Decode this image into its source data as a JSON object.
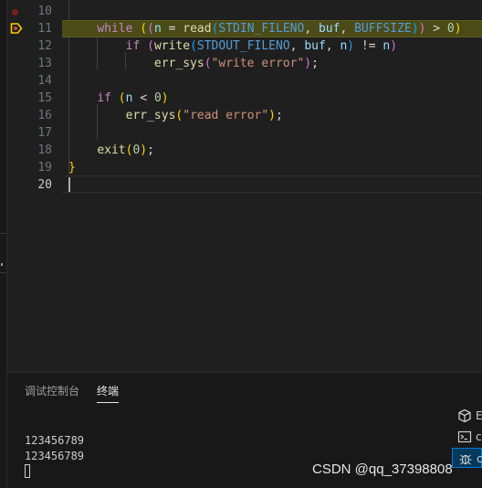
{
  "editor": {
    "lines": [
      {
        "num": "10"
      },
      {
        "num": "11",
        "tokens": [
          {
            "t": "    "
          },
          {
            "t": "while",
            "c": "kw"
          },
          {
            "t": " "
          },
          {
            "t": "(",
            "c": "p1"
          },
          {
            "t": "(",
            "c": "p2"
          },
          {
            "t": "n",
            "c": "var"
          },
          {
            "t": " = ",
            "c": "op"
          },
          {
            "t": "read",
            "c": "fn"
          },
          {
            "t": "(",
            "c": "p3"
          },
          {
            "t": "STDIN_FILENO",
            "c": "mac"
          },
          {
            "t": ", ",
            "c": "op"
          },
          {
            "t": "buf",
            "c": "var"
          },
          {
            "t": ", ",
            "c": "op"
          },
          {
            "t": "BUFFSIZE",
            "c": "mac"
          },
          {
            "t": ")",
            "c": "p3"
          },
          {
            "t": ")",
            "c": "p2"
          },
          {
            "t": " > ",
            "c": "op"
          },
          {
            "t": "0",
            "c": "num"
          },
          {
            "t": ")",
            "c": "p1"
          }
        ]
      },
      {
        "num": "12",
        "tokens": [
          {
            "t": "        "
          },
          {
            "t": "if",
            "c": "kw"
          },
          {
            "t": " "
          },
          {
            "t": "(",
            "c": "p2"
          },
          {
            "t": "write",
            "c": "fn"
          },
          {
            "t": "(",
            "c": "p3"
          },
          {
            "t": "STDOUT_FILENO",
            "c": "mac"
          },
          {
            "t": ", ",
            "c": "op"
          },
          {
            "t": "buf",
            "c": "var"
          },
          {
            "t": ", ",
            "c": "op"
          },
          {
            "t": "n",
            "c": "var"
          },
          {
            "t": ")",
            "c": "p3"
          },
          {
            "t": " != ",
            "c": "op"
          },
          {
            "t": "n",
            "c": "var"
          },
          {
            "t": ")",
            "c": "p2"
          }
        ]
      },
      {
        "num": "13",
        "tokens": [
          {
            "t": "            "
          },
          {
            "t": "err_sys",
            "c": "fn"
          },
          {
            "t": "(",
            "c": "p2"
          },
          {
            "t": "\"write error\"",
            "c": "str"
          },
          {
            "t": ")",
            "c": "p2"
          },
          {
            "t": ";",
            "c": "op"
          }
        ]
      },
      {
        "num": "14",
        "tokens": []
      },
      {
        "num": "15",
        "tokens": [
          {
            "t": "    "
          },
          {
            "t": "if",
            "c": "kw"
          },
          {
            "t": " "
          },
          {
            "t": "(",
            "c": "p1"
          },
          {
            "t": "n",
            "c": "var"
          },
          {
            "t": " < ",
            "c": "op"
          },
          {
            "t": "0",
            "c": "num"
          },
          {
            "t": ")",
            "c": "p1"
          }
        ]
      },
      {
        "num": "16",
        "tokens": [
          {
            "t": "        "
          },
          {
            "t": "err_sys",
            "c": "fn"
          },
          {
            "t": "(",
            "c": "p1"
          },
          {
            "t": "\"read error\"",
            "c": "str"
          },
          {
            "t": ")",
            "c": "p1"
          },
          {
            "t": ";",
            "c": "op"
          }
        ]
      },
      {
        "num": "17",
        "tokens": []
      },
      {
        "num": "18",
        "tokens": [
          {
            "t": "    "
          },
          {
            "t": "exit",
            "c": "fn"
          },
          {
            "t": "(",
            "c": "p1"
          },
          {
            "t": "0",
            "c": "num"
          },
          {
            "t": ")",
            "c": "p1"
          },
          {
            "t": ";",
            "c": "op"
          }
        ]
      },
      {
        "num": "19",
        "tokens": [
          {
            "t": "}",
            "c": "p1"
          }
        ]
      },
      {
        "num": "20",
        "tokens": []
      }
    ]
  },
  "panel": {
    "tabs": [
      {
        "label": "调试控制台"
      },
      {
        "label": "终端"
      }
    ],
    "terminal_output": "123456789\n123456789",
    "terminal_list": [
      {
        "icon": "package-icon",
        "label": "E"
      },
      {
        "icon": "terminal-icon",
        "label": "c"
      },
      {
        "icon": "debug-icon",
        "label": "c"
      }
    ]
  },
  "watermark": "CSDN @qq_37398808",
  "colors": {
    "editor_bg": "#1f1f1f",
    "exec_highlight": "#4b4b18",
    "breakpoint": "#7a1f1f",
    "exec_arrow": "#ffcc00",
    "keyword": "#c586c0",
    "function": "#dcdcaa",
    "variable": "#9cdcfe",
    "macro": "#569cd6",
    "string": "#ce9178",
    "number": "#b5cea8"
  }
}
